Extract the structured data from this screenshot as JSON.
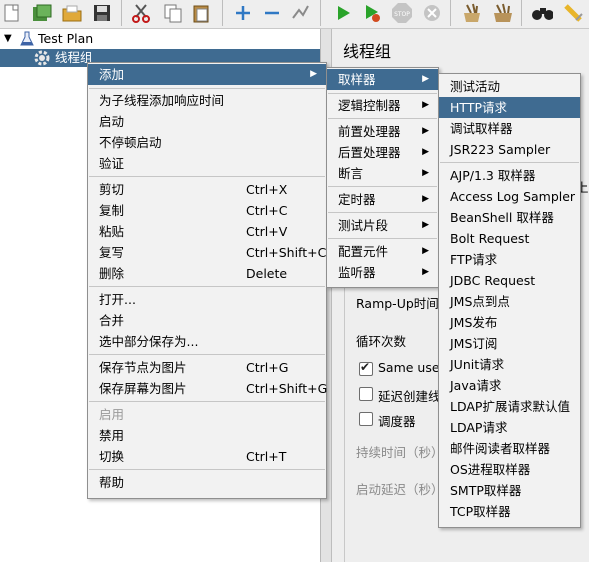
{
  "toolbar": {
    "icons": [
      "new-icon",
      "templates-icon",
      "open-icon",
      "save-icon",
      "cut-icon",
      "copy-icon",
      "paste-icon",
      "expand-icon",
      "collapse-icon",
      "toggle-icon",
      "start-icon",
      "start-no-pause-icon",
      "stop-icon",
      "shutdown-icon",
      "clear-icon",
      "clear-all-icon",
      "search-icon",
      "reset-search-icon"
    ],
    "stop_text": "STOP"
  },
  "tree": {
    "root_label": "Test Plan",
    "child_label": "线程组",
    "expand_glyph": "▼"
  },
  "right_panel": {
    "title": "线程组",
    "ramp_up_label": "Ramp-Up时间",
    "loop_label": "循环次数",
    "same_user_label": "Same user",
    "delay_create_label": "延迟创建线",
    "scheduler_label": "调度器",
    "duration_label": "持续时间（秒）",
    "startup_delay_label": "启动延迟（秒）",
    "edge_text": "上"
  },
  "context_menu": {
    "items": [
      {
        "label": "添加",
        "has_submenu": true,
        "highlighted": true
      },
      {
        "label": "为子线程添加响应时间"
      },
      {
        "label": "启动"
      },
      {
        "label": "不停顿启动"
      },
      {
        "label": "验证"
      },
      {
        "label": "剪切",
        "shortcut": "Ctrl+X"
      },
      {
        "label": "复制",
        "shortcut": "Ctrl+C"
      },
      {
        "label": "粘贴",
        "shortcut": "Ctrl+V"
      },
      {
        "label": "复写",
        "shortcut": "Ctrl+Shift+C"
      },
      {
        "label": "删除",
        "shortcut": "Delete"
      },
      {
        "label": "打开..."
      },
      {
        "label": "合并"
      },
      {
        "label": "选中部分保存为..."
      },
      {
        "label": "保存节点为图片",
        "shortcut": "Ctrl+G"
      },
      {
        "label": "保存屏幕为图片",
        "shortcut": "Ctrl+Shift+G"
      },
      {
        "label": "启用",
        "disabled": true
      },
      {
        "label": "禁用"
      },
      {
        "label": "切换",
        "shortcut": "Ctrl+T"
      },
      {
        "label": "帮助"
      }
    ]
  },
  "add_submenu": {
    "items": [
      {
        "label": "取样器",
        "highlighted": true
      },
      {
        "label": "逻辑控制器"
      },
      {
        "label": "前置处理器"
      },
      {
        "label": "后置处理器"
      },
      {
        "label": "断言"
      },
      {
        "label": "定时器"
      },
      {
        "label": "测试片段"
      },
      {
        "label": "配置元件"
      },
      {
        "label": "监听器"
      }
    ]
  },
  "sampler_submenu": {
    "items": [
      {
        "label": "测试活动"
      },
      {
        "label": "HTTP请求",
        "highlighted": true
      },
      {
        "label": "调试取样器"
      },
      {
        "label": "JSR223 Sampler"
      },
      {
        "label": "AJP/1.3 取样器"
      },
      {
        "label": "Access Log Sampler"
      },
      {
        "label": "BeanShell 取样器"
      },
      {
        "label": "Bolt Request"
      },
      {
        "label": "FTP请求"
      },
      {
        "label": "JDBC Request"
      },
      {
        "label": "JMS点到点"
      },
      {
        "label": "JMS发布"
      },
      {
        "label": "JMS订阅"
      },
      {
        "label": "JUnit请求"
      },
      {
        "label": "Java请求"
      },
      {
        "label": "LDAP扩展请求默认值"
      },
      {
        "label": "LDAP请求"
      },
      {
        "label": "邮件阅读者取样器"
      },
      {
        "label": "OS进程取样器"
      },
      {
        "label": "SMTP取样器"
      },
      {
        "label": "TCP取样器"
      }
    ]
  },
  "arrow_glyph": "▶",
  "check_glyph": "✔"
}
